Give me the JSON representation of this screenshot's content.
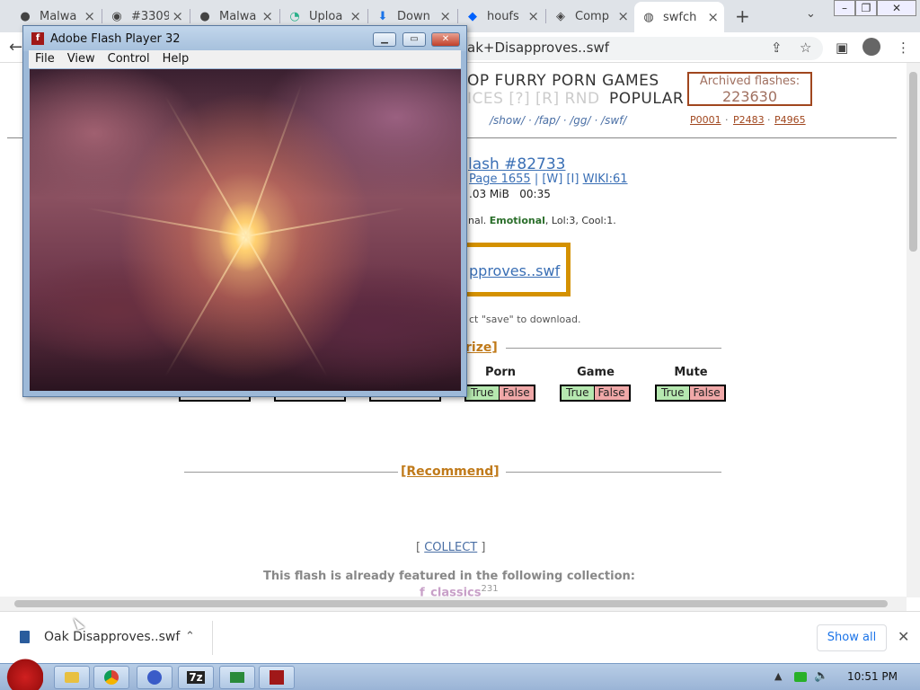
{
  "browser": {
    "tabs": [
      {
        "icon": "github-icon",
        "title": "Malwa"
      },
      {
        "icon": "issue-icon",
        "title": "#3309"
      },
      {
        "icon": "github-icon",
        "title": "Malwa"
      },
      {
        "icon": "upload-icon",
        "title": "Uploa"
      },
      {
        "icon": "download-icon",
        "title": "Down"
      },
      {
        "icon": "dropbox-icon",
        "title": "houfs"
      },
      {
        "icon": "compare-icon",
        "title": "Comp"
      },
      {
        "icon": "swfchan-icon",
        "title": "swfch"
      }
    ],
    "new_tab": "+",
    "address_text": "ak+Disapproves..swf"
  },
  "page": {
    "nav_row1": "OP   FURRY   PORN   GAMES",
    "nav_row2_faded": "ICES  [?]  [R]  RND",
    "nav_row2_popular": "POPULAR",
    "archive_label": "Archived flashes:",
    "archive_count": "223630",
    "board_links": "/show/  ·  /fap/  ·  /gg/  ·  /swf/",
    "p_links": [
      "P0001",
      "P2483",
      "P4965"
    ],
    "p_sep": "·",
    "flash_title": "lash #82733",
    "page_link": "Page 1655",
    "page_link_extra": " | [W] [I] ",
    "wiki_link": "WIKI:61",
    "size": ".03 MiB",
    "duration": "00:35",
    "tags_prefix": "nal. ",
    "tags_bold": "Emotional",
    "tags_suffix": ", Lol:3, Cool:1.",
    "download_link": "pproves..swf",
    "save_hint": "ct \"save\" to download.",
    "categorize_title": "rize]",
    "vote_headers": [
      "Porn",
      "Game",
      "Mute"
    ],
    "true_label": "True",
    "false_label": "False",
    "recommend_title": "[Recommend]",
    "collect_open": "[ ",
    "collect_label": "COLLECT",
    "collect_close": " ]",
    "featured_text": "This flash is already featured in the following collection:",
    "classics_label": "f_classics",
    "classics_count": "231"
  },
  "flash_player": {
    "title": "Adobe Flash Player 32",
    "menu": [
      "File",
      "View",
      "Control",
      "Help"
    ]
  },
  "downloads": {
    "filename": "Oak Disapproves..swf",
    "show_all": "Show all"
  },
  "taskbar": {
    "apps": [
      "folder-icon",
      "chrome-icon",
      "media-icon",
      "7zip-icon",
      "box-icon",
      "flash-icon"
    ],
    "app_7zip_label": "7z",
    "clock": "10:51 PM"
  },
  "colors": {
    "accent_link": "#3a6fb5",
    "archive_border": "#a0461e",
    "download_border": "#d49100",
    "true_green": "#b6e8b0",
    "false_red": "#f0a8a8"
  }
}
